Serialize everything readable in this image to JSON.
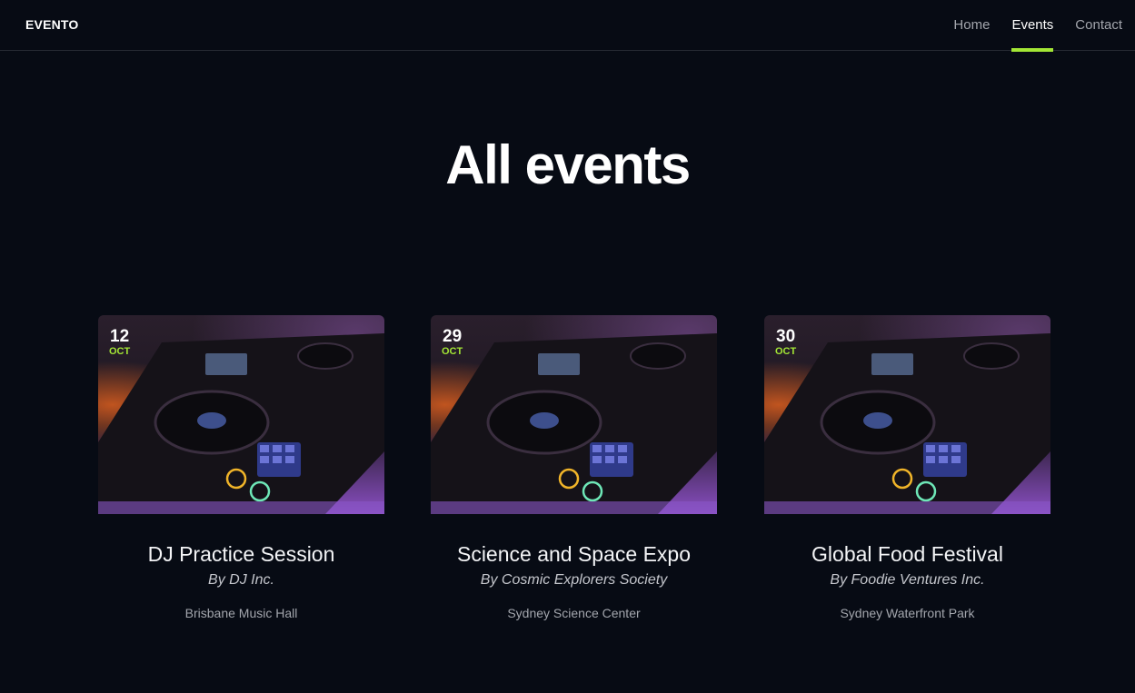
{
  "header": {
    "logo": "EVENTO",
    "nav": [
      {
        "label": "Home",
        "active": false
      },
      {
        "label": "Events",
        "active": true
      },
      {
        "label": "Contact",
        "active": false
      }
    ]
  },
  "page": {
    "title": "All events"
  },
  "events": [
    {
      "day": "12",
      "month": "OCT",
      "title": "DJ Practice Session",
      "organizer": "By DJ Inc.",
      "venue": "Brisbane Music Hall"
    },
    {
      "day": "29",
      "month": "OCT",
      "title": "Science and Space Expo",
      "organizer": "By Cosmic Explorers Society",
      "venue": "Sydney Science Center"
    },
    {
      "day": "30",
      "month": "OCT",
      "title": "Global Food Festival",
      "organizer": "By Foodie Ventures Inc.",
      "venue": "Sydney Waterfront Park"
    }
  ],
  "colors": {
    "accent": "#a3e635",
    "background": "#070b14"
  }
}
